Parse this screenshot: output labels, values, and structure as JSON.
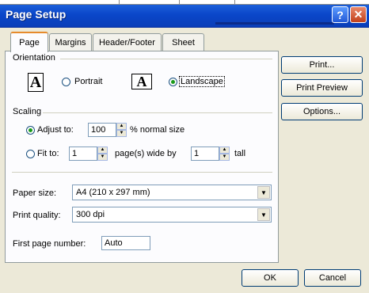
{
  "window": {
    "title": "Page Setup"
  },
  "tabs": [
    {
      "label": "Page"
    },
    {
      "label": "Margins"
    },
    {
      "label": "Header/Footer"
    },
    {
      "label": "Sheet"
    }
  ],
  "orientation": {
    "group_label": "Orientation",
    "portrait_label": "Portrait",
    "landscape_label": "Landscape",
    "icon_glyph": "A",
    "selected": "landscape"
  },
  "scaling": {
    "group_label": "Scaling",
    "adjust_label": "Adjust to:",
    "adjust_value": "100",
    "adjust_suffix": "% normal size",
    "fit_label": "Fit to:",
    "fit_wide_value": "1",
    "fit_wide_suffix": "page(s) wide by",
    "fit_tall_value": "1",
    "fit_tall_suffix": "tall",
    "selected": "adjust"
  },
  "paper": {
    "size_label": "Paper size:",
    "size_value": "A4 (210 x 297 mm)",
    "quality_label": "Print quality:",
    "quality_value": "300 dpi",
    "first_page_label": "First page number:",
    "first_page_value": "Auto"
  },
  "side_buttons": {
    "print": "Print...",
    "print_preview": "Print Preview",
    "options": "Options..."
  },
  "footer": {
    "ok": "OK",
    "cancel": "Cancel"
  },
  "colors": {
    "titlebar": "#0a46c9",
    "dialog_bg": "#ece9d8",
    "tab_highlight": "#e68b2c",
    "radio_dot": "#1a9a1a"
  }
}
